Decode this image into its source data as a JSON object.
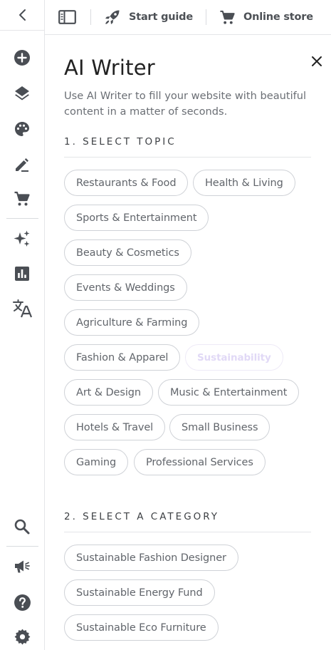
{
  "topbar": {
    "start_guide_label": "Start guide",
    "online_store_label": "Online store"
  },
  "rail": {
    "icons": [
      "back-chevron-icon",
      "add-circle-icon",
      "layers-icon",
      "palette-icon",
      "edit-icon",
      "cart-icon",
      "ai-sparkle-icon",
      "chart-icon",
      "translate-icon",
      "search-icon",
      "megaphone-icon",
      "help-icon",
      "settings-icon"
    ]
  },
  "panel": {
    "title": "AI Writer",
    "description": "Use AI Writer to fill your website with beautiful content in a matter of seconds.",
    "topic_heading": "1. SELECT TOPIC",
    "topics": [
      {
        "label": "Restaurants & Food",
        "state": "default"
      },
      {
        "label": "Health & Living",
        "state": "default"
      },
      {
        "label": "Sports & Entertainment",
        "state": "default"
      },
      {
        "label": "Beauty & Cosmetics",
        "state": "default"
      },
      {
        "label": "Events & Weddings",
        "state": "default"
      },
      {
        "label": "Agriculture & Farming",
        "state": "default"
      },
      {
        "label": "Fashion & Apparel",
        "state": "default"
      },
      {
        "label": "Sustainability",
        "state": "selected"
      },
      {
        "label": "Art & Design",
        "state": "default"
      },
      {
        "label": "Music & Entertainment",
        "state": "default"
      },
      {
        "label": "Hotels & Travel",
        "state": "default"
      },
      {
        "label": "Small Business",
        "state": "default"
      },
      {
        "label": "Gaming",
        "state": "default"
      },
      {
        "label": "Professional Services",
        "state": "default"
      }
    ],
    "category_heading": "2. SELECT A CATEGORY",
    "categories": [
      {
        "label": "Sustainable Fashion Designer"
      },
      {
        "label": "Sustainable Energy Fund"
      },
      {
        "label": "Sustainable Eco Furniture"
      }
    ]
  },
  "colors": {
    "icon": "#4a4e54",
    "border": "#e4e5e8",
    "chip_border": "#cfd2d7",
    "selected_chip_text": "#e1d9f6"
  }
}
